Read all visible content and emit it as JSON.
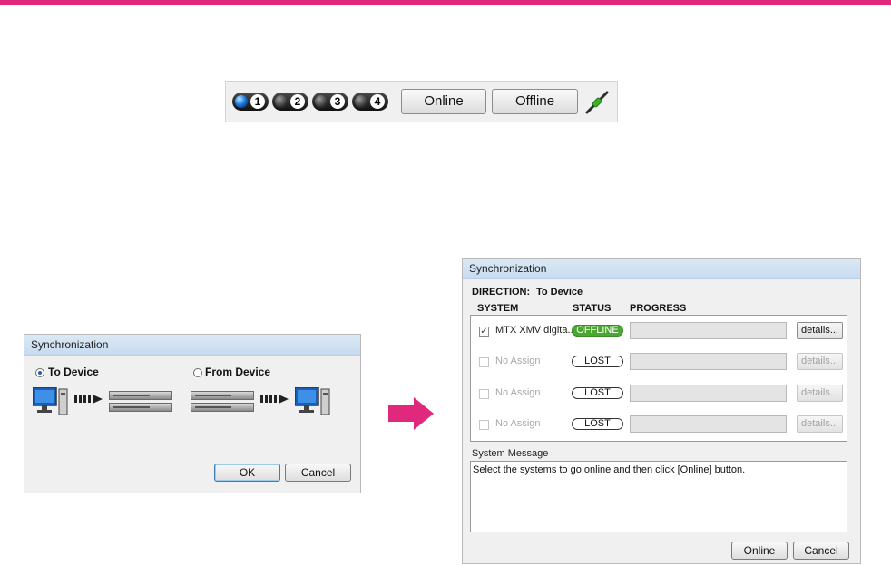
{
  "colors": {
    "accent_bar": "#e0287d",
    "pink_arrow": "#e0287d",
    "offline_green": "#4aa832",
    "led_blue": "#1d7fe0"
  },
  "toolbar": {
    "systems": [
      {
        "label": "1",
        "active": true
      },
      {
        "label": "2",
        "active": false
      },
      {
        "label": "3",
        "active": false
      },
      {
        "label": "4",
        "active": false
      }
    ],
    "online_label": "Online",
    "offline_label": "Offline",
    "status_icon": "plug-connector-icon"
  },
  "sync_dialog_small": {
    "title": "Synchronization",
    "to_device_label": "To Device",
    "from_device_label": "From Device",
    "selected": "To Device",
    "ok_label": "OK",
    "cancel_label": "Cancel"
  },
  "sync_dialog_large": {
    "title": "Synchronization",
    "direction_label": "DIRECTION:",
    "direction_value": "To Device",
    "col_system": "SYSTEM",
    "col_status": "STATUS",
    "col_progress": "PROGRESS",
    "rows": [
      {
        "checked": true,
        "enabled": true,
        "system": "MTX XMV digita...",
        "status": "OFFLINE",
        "details": "details..."
      },
      {
        "checked": false,
        "enabled": false,
        "system": "No Assign",
        "status": "LOST",
        "details": "details..."
      },
      {
        "checked": false,
        "enabled": false,
        "system": "No Assign",
        "status": "LOST",
        "details": "details..."
      },
      {
        "checked": false,
        "enabled": false,
        "system": "No Assign",
        "status": "LOST",
        "details": "details..."
      }
    ],
    "message_label": "System Message",
    "message_text": "Select the systems to go online and then click [Online] button.",
    "online_label": "Online",
    "cancel_label": "Cancel"
  }
}
